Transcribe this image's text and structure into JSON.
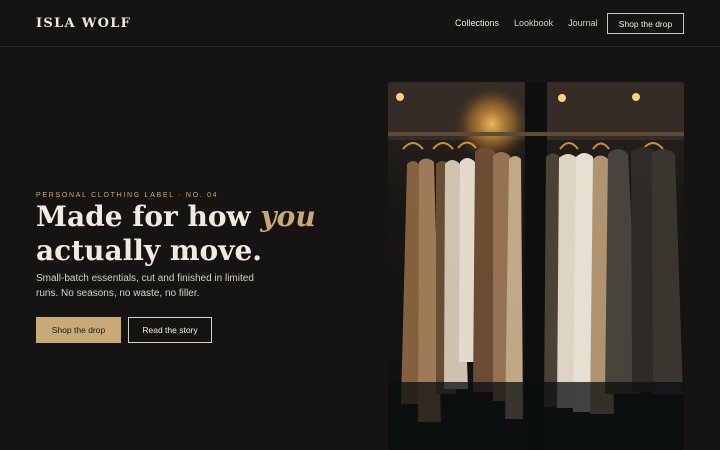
{
  "brand": {
    "name": "ISLA WOLF"
  },
  "nav": {
    "links": [
      "Collections",
      "Lookbook",
      "Journal"
    ],
    "cta": "Shop the drop"
  },
  "hero": {
    "eyebrow": "PERSONAL CLOTHING LABEL · NO. 04",
    "headline_part1": "Made for how ",
    "headline_accent": "you",
    "headline_part2": "actually move.",
    "description": "Small-batch essentials, cut and finished in limited runs. No seasons, no waste, no filler.",
    "primary_cta": "Shop the drop",
    "secondary_cta": "Read the story"
  },
  "colors": {
    "background": "#151413",
    "accent": "#c8a978",
    "text": "#f1ebdf"
  }
}
